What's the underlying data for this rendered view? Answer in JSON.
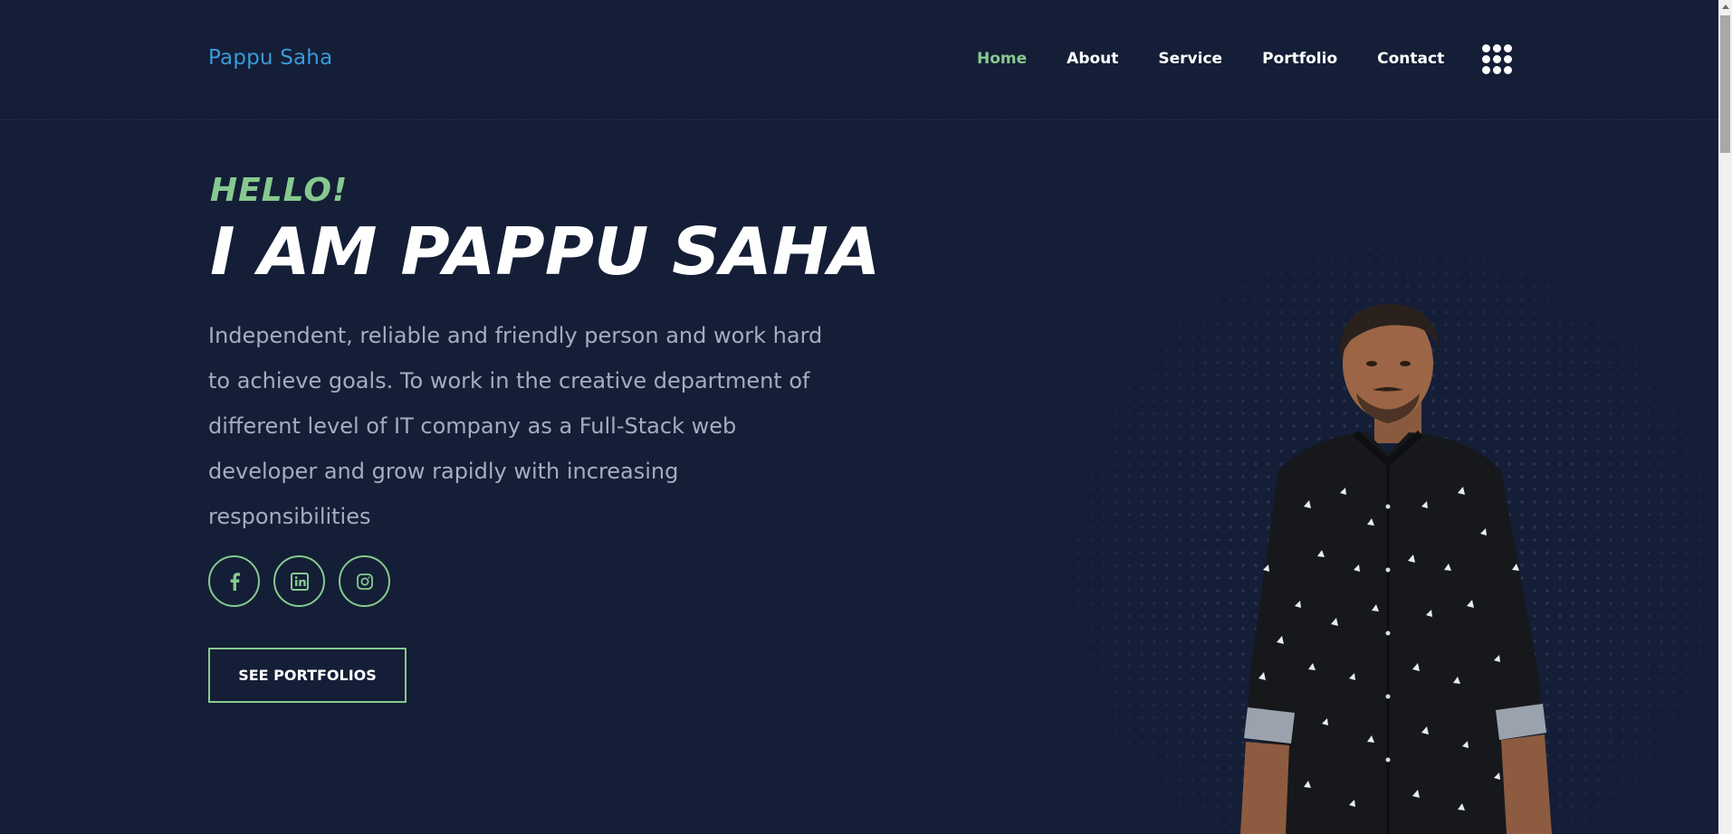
{
  "header": {
    "logo": "Pappu Saha",
    "nav": [
      {
        "label": "Home",
        "active": true
      },
      {
        "label": "About",
        "active": false
      },
      {
        "label": "Service",
        "active": false
      },
      {
        "label": "Portfolio",
        "active": false
      },
      {
        "label": "Contact",
        "active": false
      }
    ],
    "menu_icon": "grid-dots-icon"
  },
  "hero": {
    "greeting": "HELLO!",
    "headline": "I AM PAPPU SAHA",
    "description": "Independent, reliable and friendly person and work hard to achieve goals. To work in the creative department of different level of IT company as a Full-Stack web developer and grow rapidly with increasing responsibilities",
    "socials": [
      {
        "icon": "facebook-icon"
      },
      {
        "icon": "linkedin-icon"
      },
      {
        "icon": "instagram-icon"
      }
    ],
    "cta_label": "SEE PORTFOLIOS"
  },
  "colors": {
    "background": "#141e36",
    "accent_green": "#86c98f",
    "logo_blue": "#3a9ad9",
    "text_muted": "#a4adbf",
    "white": "#ffffff"
  }
}
